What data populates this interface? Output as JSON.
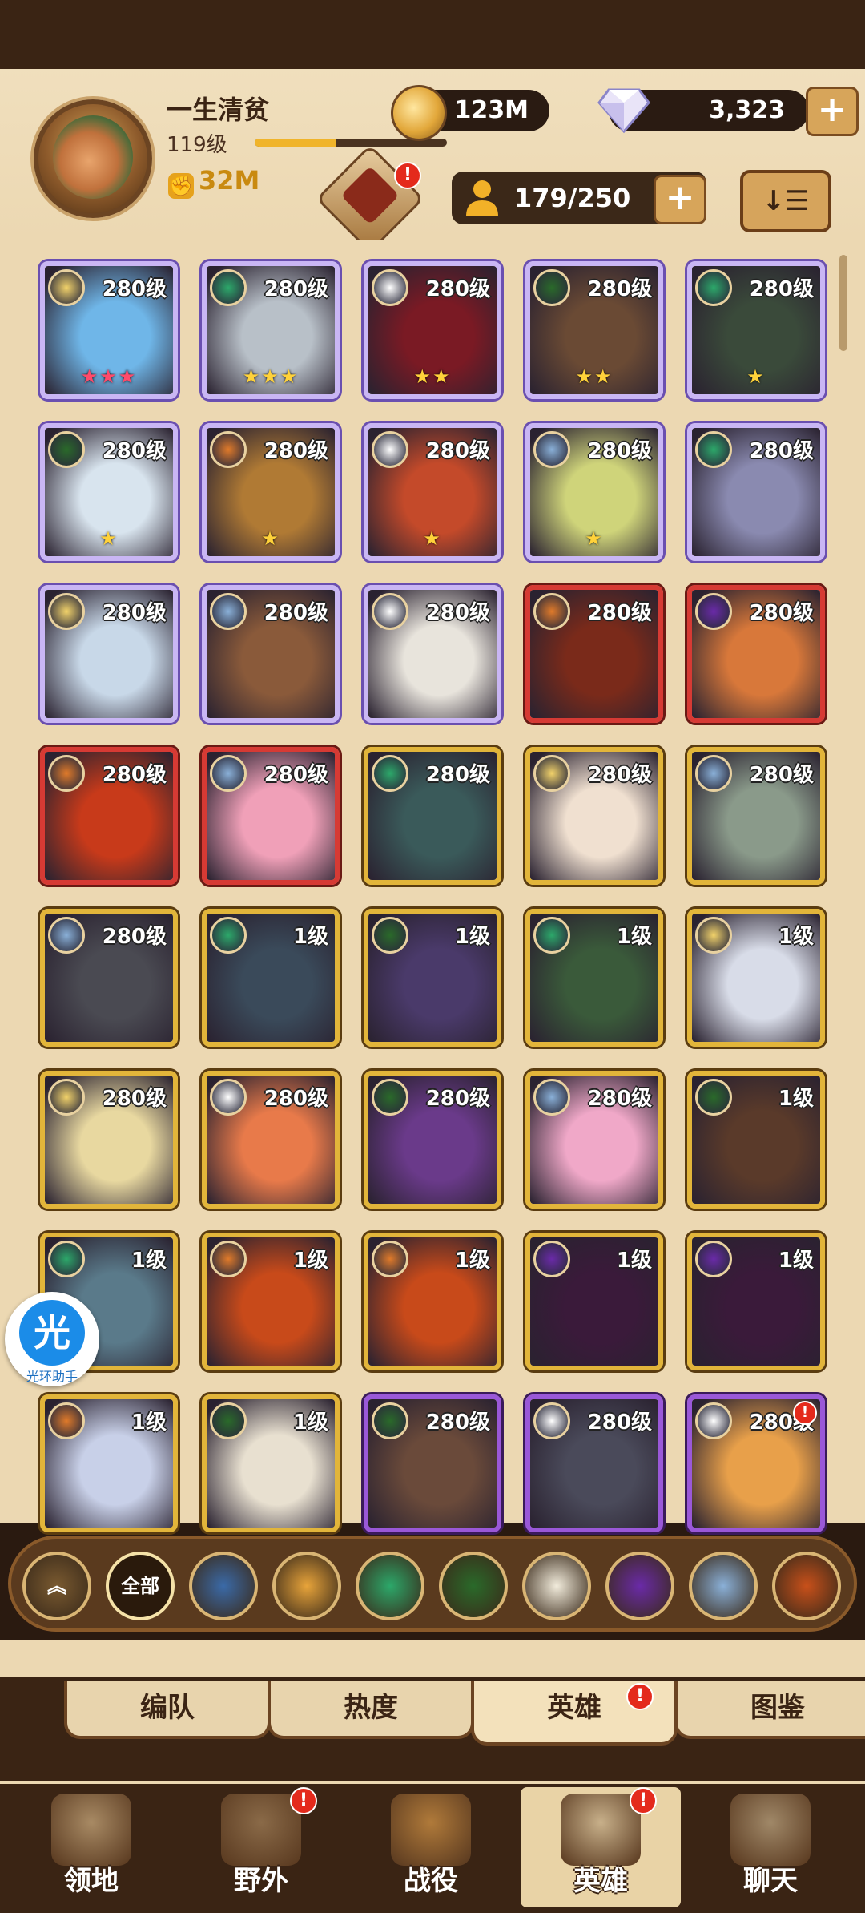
{
  "player": {
    "name": "一生清贫",
    "level": "119级",
    "level_progress": 0.42,
    "power": "32M"
  },
  "resources": {
    "gold": "123M",
    "diamonds": "3,323",
    "plus": "+"
  },
  "emblem_badge": "!",
  "hero_count": {
    "value": "179/250",
    "plus": "+"
  },
  "sort_label": "↓☰",
  "heroes": [
    {
      "level": "280级",
      "frame": "purple",
      "faction": "lightbearer",
      "stars": "★★★",
      "star_color": "red",
      "portrait": "#6fb6e8"
    },
    {
      "level": "280级",
      "frame": "purple",
      "faction": "wilder",
      "stars": "★★★",
      "star_color": "gold",
      "portrait": "#b8c0c8"
    },
    {
      "level": "280级",
      "frame": "purple",
      "faction": "celestial",
      "stars": "★★",
      "star_color": "gold",
      "portrait": "#7a1a24"
    },
    {
      "level": "280级",
      "frame": "purple",
      "faction": "graveborn",
      "stars": "★★",
      "star_color": "gold",
      "portrait": "#6a4a34"
    },
    {
      "level": "280级",
      "frame": "purple",
      "faction": "wilder",
      "stars": "★",
      "star_color": "gold",
      "portrait": "#3a4a3a"
    },
    {
      "level": "280级",
      "frame": "purple",
      "faction": "graveborn",
      "stars": "★",
      "star_color": "gold",
      "portrait": "#d8e4ee"
    },
    {
      "level": "280级",
      "frame": "purple",
      "faction": "mauler",
      "stars": "★",
      "star_color": "gold",
      "portrait": "#b07a34"
    },
    {
      "level": "280级",
      "frame": "purple",
      "faction": "celestial",
      "stars": "★",
      "star_color": "gold",
      "portrait": "#c44a2a"
    },
    {
      "level": "280级",
      "frame": "purple",
      "faction": "dimensional",
      "stars": "★",
      "star_color": "gold",
      "portrait": "#cfd47a"
    },
    {
      "level": "280级",
      "frame": "purple",
      "faction": "wilder",
      "stars": "",
      "star_color": "gold",
      "portrait": "#8a8ab0"
    },
    {
      "level": "280级",
      "frame": "purple",
      "faction": "lightbearer",
      "stars": "",
      "star_color": "gold",
      "portrait": "#c8d8e8"
    },
    {
      "level": "280级",
      "frame": "purple",
      "faction": "dimensional",
      "stars": "",
      "star_color": "gold",
      "portrait": "#8a5a3a"
    },
    {
      "level": "280级",
      "frame": "purple",
      "faction": "celestial",
      "stars": "",
      "star_color": "gold",
      "portrait": "#e8e4dc"
    },
    {
      "level": "280级",
      "frame": "red",
      "faction": "mauler",
      "stars": "",
      "star_color": "gold",
      "portrait": "#7a2a1a"
    },
    {
      "level": "280级",
      "frame": "red",
      "faction": "hypogean",
      "stars": "",
      "star_color": "gold",
      "portrait": "#d8783a"
    },
    {
      "level": "280级",
      "frame": "red",
      "faction": "mauler",
      "stars": "",
      "star_color": "gold",
      "portrait": "#c83a1a"
    },
    {
      "level": "280级",
      "frame": "red",
      "faction": "dimensional",
      "stars": "",
      "star_color": "gold",
      "portrait": "#f0a0b8"
    },
    {
      "level": "280级",
      "frame": "gold",
      "faction": "wilder",
      "stars": "",
      "star_color": "gold",
      "portrait": "#3a5a5a"
    },
    {
      "level": "280级",
      "frame": "gold",
      "faction": "lightbearer",
      "stars": "",
      "star_color": "gold",
      "portrait": "#f0e0d0"
    },
    {
      "level": "280级",
      "frame": "gold",
      "faction": "dimensional",
      "stars": "",
      "star_color": "gold",
      "portrait": "#8a9a8a"
    },
    {
      "level": "280级",
      "frame": "gold",
      "faction": "dimensional",
      "stars": "",
      "star_color": "gold",
      "portrait": "#4a4a52"
    },
    {
      "level": "1级",
      "frame": "gold",
      "faction": "wilder",
      "stars": "",
      "star_color": "gold",
      "portrait": "#3a4a5a"
    },
    {
      "level": "1级",
      "frame": "gold",
      "faction": "graveborn",
      "stars": "",
      "star_color": "gold",
      "portrait": "#4a3a6a"
    },
    {
      "level": "1级",
      "frame": "gold",
      "faction": "wilder",
      "stars": "",
      "star_color": "gold",
      "portrait": "#3a5a3a"
    },
    {
      "level": "1级",
      "frame": "gold",
      "faction": "lightbearer",
      "stars": "",
      "star_color": "gold",
      "portrait": "#d8dce8"
    },
    {
      "level": "280级",
      "frame": "gold",
      "faction": "lightbearer",
      "stars": "",
      "star_color": "gold",
      "portrait": "#e8d8a0"
    },
    {
      "level": "280级",
      "frame": "gold",
      "faction": "celestial",
      "stars": "",
      "star_color": "gold",
      "portrait": "#e87a4a"
    },
    {
      "level": "280级",
      "frame": "gold",
      "faction": "graveborn",
      "stars": "",
      "star_color": "gold",
      "portrait": "#6a3a8a"
    },
    {
      "level": "280级",
      "frame": "gold",
      "faction": "dimensional",
      "stars": "",
      "star_color": "gold",
      "portrait": "#f0a8c8"
    },
    {
      "level": "1级",
      "frame": "gold",
      "faction": "graveborn",
      "stars": "",
      "star_color": "gold",
      "portrait": "#5a3a2a"
    },
    {
      "level": "1级",
      "frame": "gold",
      "faction": "wilder",
      "stars": "",
      "star_color": "gold",
      "portrait": "#5a7a8a"
    },
    {
      "level": "1级",
      "frame": "gold",
      "faction": "mauler",
      "stars": "",
      "star_color": "gold",
      "portrait": "#c84a1a"
    },
    {
      "level": "1级",
      "frame": "gold",
      "faction": "mauler",
      "stars": "",
      "star_color": "gold",
      "portrait": "#c84a1a"
    },
    {
      "level": "1级",
      "frame": "gold",
      "faction": "hypogean",
      "stars": "",
      "star_color": "gold",
      "portrait": "#3a1a3a"
    },
    {
      "level": "1级",
      "frame": "gold",
      "faction": "hypogean",
      "stars": "",
      "star_color": "gold",
      "portrait": "#3a1a3a"
    },
    {
      "level": "1级",
      "frame": "gold",
      "faction": "mauler",
      "stars": "",
      "star_color": "gold",
      "portrait": "#c8d0e8"
    },
    {
      "level": "1级",
      "frame": "gold",
      "faction": "graveborn",
      "stars": "",
      "star_color": "gold",
      "portrait": "#e8e0d0"
    },
    {
      "level": "280级",
      "frame": "violet",
      "faction": "graveborn",
      "stars": "",
      "star_color": "gold",
      "portrait": "#6a4a3a"
    },
    {
      "level": "280级",
      "frame": "violet",
      "faction": "celestial",
      "stars": "",
      "star_color": "gold",
      "portrait": "#4a4a5a"
    },
    {
      "level": "280级",
      "frame": "violet",
      "faction": "celestial",
      "stars": "",
      "star_color": "gold",
      "portrait": "#e8a04a",
      "notify": "!"
    }
  ],
  "helper": {
    "glyph": "光",
    "label": "光环助手"
  },
  "filters": [
    {
      "name": "filter-collapse",
      "label": "︽",
      "color": "#7a5a30"
    },
    {
      "name": "filter-all",
      "label": "全部",
      "color": "#2a1a0c",
      "selected": true
    },
    {
      "name": "filter-lightbearer",
      "label": "",
      "color": "#3a6aa8"
    },
    {
      "name": "filter-mauler",
      "label": "",
      "color": "#e8a43a"
    },
    {
      "name": "filter-wilder",
      "label": "",
      "color": "#2ca86a"
    },
    {
      "name": "filter-graveborn",
      "label": "",
      "color": "#2a6a2a"
    },
    {
      "name": "filter-celestial",
      "label": "",
      "color": "#f2ecdc"
    },
    {
      "name": "filter-hypogean",
      "label": "",
      "color": "#6a2aa8"
    },
    {
      "name": "filter-dimensional",
      "label": "",
      "color": "#8ab0d8"
    },
    {
      "name": "filter-draconis",
      "label": "",
      "color": "#c8501a"
    }
  ],
  "subtabs": [
    {
      "label": "编队",
      "active": false
    },
    {
      "label": "热度",
      "active": false
    },
    {
      "label": "英雄",
      "active": true,
      "badge": "!"
    },
    {
      "label": "图鉴",
      "active": false
    }
  ],
  "nav": [
    {
      "label": "领地",
      "active": false,
      "color": "#a88a64"
    },
    {
      "label": "野外",
      "active": false,
      "color": "#8a6a48",
      "badge": "!"
    },
    {
      "label": "战役",
      "active": false,
      "color": "#b07a3a"
    },
    {
      "label": "英雄",
      "active": true,
      "color": "#c8b08a",
      "badge": "!"
    },
    {
      "label": "聊天",
      "active": false,
      "color": "#a08868"
    }
  ],
  "faction_colors": {
    "lightbearer": "#f2d26a",
    "mauler": "#e07a2a",
    "wilder": "#2ca86a",
    "graveborn": "#2a6a2a",
    "celestial": "#ffffff",
    "hypogean": "#6a2aa8",
    "dimensional": "#8ab0d8",
    "draconis": "#c8501a"
  }
}
